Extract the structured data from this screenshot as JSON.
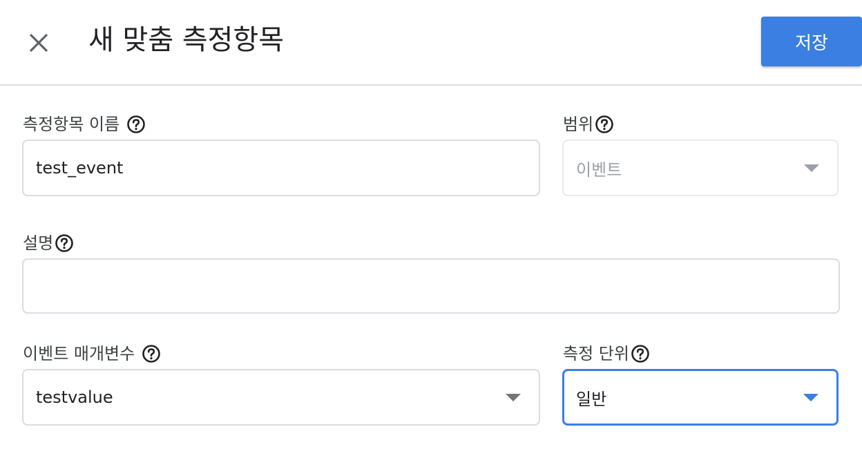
{
  "dialog": {
    "title": "새 맞춤 측정항목",
    "save_label": "저장"
  },
  "form": {
    "metric_name": {
      "label": "측정항목 이름",
      "value": "test_event"
    },
    "scope": {
      "label": "범위",
      "value": "이벤트",
      "disabled": true
    },
    "description": {
      "label": "설명",
      "value": ""
    },
    "event_parameter": {
      "label": "이벤트 매개변수",
      "value": "testvalue"
    },
    "unit_of_measurement": {
      "label": "측정 단위",
      "value": "일반",
      "focused": true
    }
  },
  "icons": {
    "close": "close-icon",
    "help": "help-circle-icon",
    "dropdown": "arrow-drop-down-icon"
  },
  "colors": {
    "accent": "#3a7fe1",
    "border": "#dadce0",
    "text": "#202124",
    "disabled_text": "#9aa0a6"
  }
}
